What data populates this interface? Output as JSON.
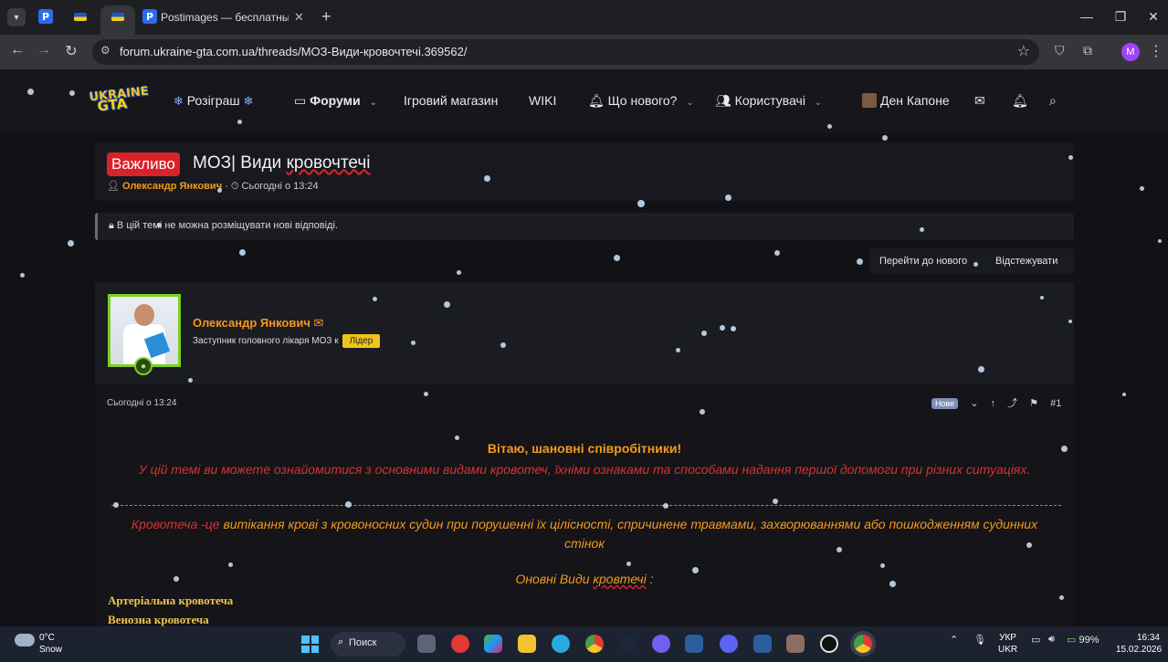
{
  "browser": {
    "tab_title": "Postimages — бесплатный хос",
    "url": "forum.ukraine-gta.com.ua/threads/МОЗ-Види-кровочтечі.369562/",
    "profile_initial": "M"
  },
  "site": {
    "logo_top": "UKRAINE",
    "logo_bottom": "GTA",
    "nav": {
      "giveaway": "Розіграш",
      "forums": "Форуми",
      "shop": "Ігровий магазин",
      "wiki": "WIKI",
      "whats_new": "Що нового?",
      "members": "Користувачі",
      "username": "Ден Капоне"
    }
  },
  "thread": {
    "prefix": "Важливо",
    "title_a": "МОЗ| Види ",
    "title_b": "кровочтечі",
    "author": "Олександр Янкович",
    "time": "Сьогодні о 13:24",
    "notice": "В цій темі не можна розміщувати нові відповіді.",
    "goto_new": "Перейти до нового",
    "watch": "Відстежувати"
  },
  "post": {
    "author_name": "Олександр Янкович",
    "author_role": "Заступник головного лікаря МОЗ к",
    "role_tag": "Лідер",
    "time": "Сьогодні о 13:24",
    "new_tag": "Нове",
    "number": "#1",
    "greeting": "Вітаю, шановні співробітники!",
    "intro": "У цій темі ви можете ознайомитися з основними видами кровотеч, їхніми ознаками та способами надання першої допомоги при різних ситуаціях.",
    "def_red": "Кровотеча -це ",
    "def_orange": "витікання крові з кровоносних судин при порушенні їх цілісності, спричинене травмами, захворюваннями або пошкодженням судинних стінок",
    "types_title_a": "Оновні Види ",
    "types_title_b": "кровтечі",
    "types_title_c": " :",
    "type_1": "Артеріальна кровотеча",
    "type_2": "Венозна кровотеча"
  },
  "taskbar": {
    "temp": "0°C",
    "weather": "Snow",
    "search": "Поиск",
    "battery": "99%",
    "lang_1": "УКР",
    "lang_2": "UKR",
    "time": "16:34",
    "date": "15.02.2026"
  }
}
